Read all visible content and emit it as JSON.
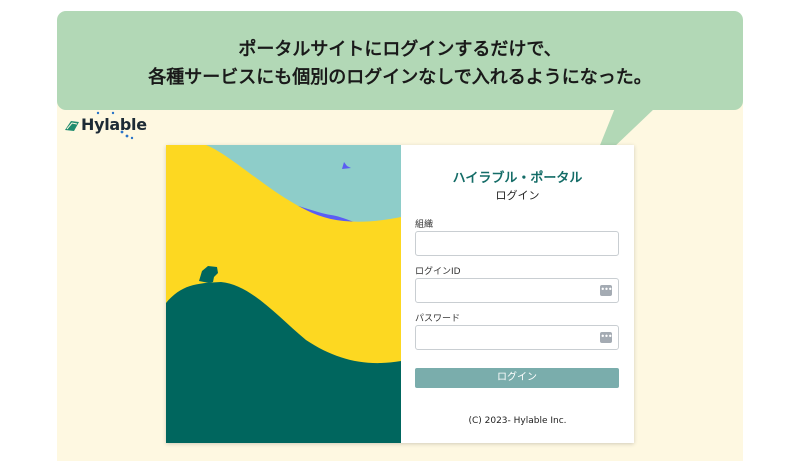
{
  "callout": {
    "line1": "ポータルサイトにログインするだけで、",
    "line2": "各種サービスにも個別のログインなしで入れるようになった。"
  },
  "logo": {
    "text": "Hylable"
  },
  "portal": {
    "title": "ハイラブル・ポータル",
    "subtitle": "ログイン",
    "fields": {
      "organization": {
        "label": "組織",
        "value": "",
        "placeholder": ""
      },
      "login_id": {
        "label": "ログインID",
        "value": "",
        "placeholder": ""
      },
      "password": {
        "label": "パスワード",
        "value": "",
        "placeholder": ""
      }
    },
    "login_button": "ログイン",
    "copyright": "(C) 2023- Hylable Inc."
  },
  "colors": {
    "callout_bg": "#b2d8b6",
    "backdrop": "#fef8e1",
    "art_sky": "#8ecdc9",
    "art_purple": "#5b5df3",
    "art_yellow": "#fdd821",
    "art_green": "#00665e",
    "title_teal": "#146c67",
    "button": "#7aadac"
  },
  "icons": {
    "login_id_field": "autofill-key-icon",
    "password_field": "autofill-key-icon",
    "logo_mark": "wing-icon"
  }
}
